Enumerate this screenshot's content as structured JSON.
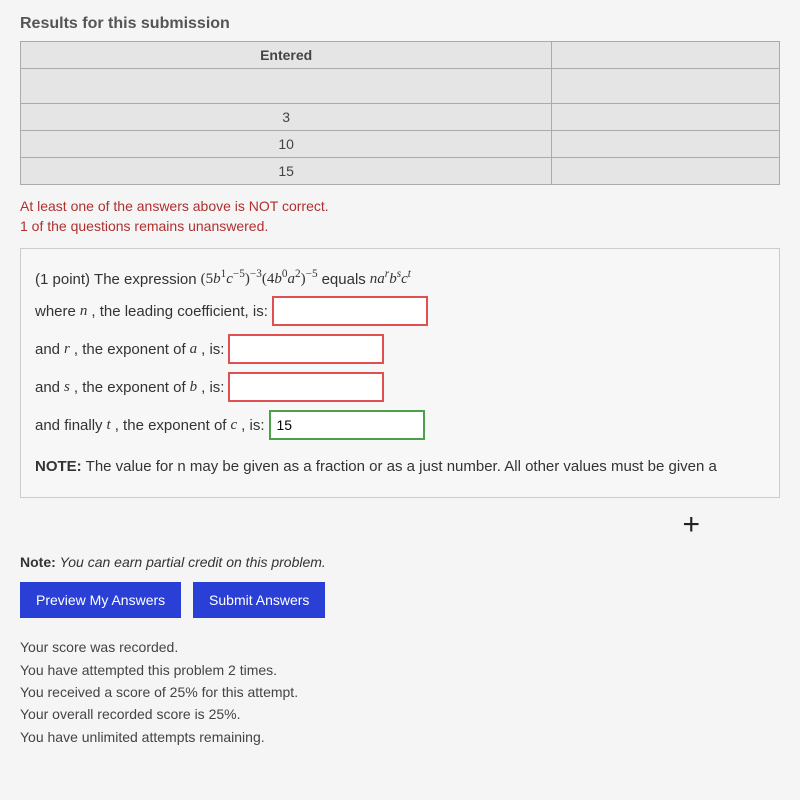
{
  "results": {
    "heading": "Results for this submission",
    "col1_header": "Entered",
    "col2_header": "",
    "rows": [
      "3",
      "10",
      "15"
    ]
  },
  "feedback": {
    "line1": "At least one of the answers above is NOT correct.",
    "line2": "1 of the questions remains unanswered."
  },
  "problem": {
    "points": "(1 point) ",
    "intro": "The expression ",
    "expr_html": "(5b¹c⁻⁵)⁻³(4b⁰a²)⁻⁵",
    "equals": " equals ",
    "target_html": "naʳbˢcᵗ",
    "n_label_pre": "where ",
    "n_label": ", the leading coefficient, is:",
    "r_label_pre": "and ",
    "r_label": ", the exponent of ",
    "r_label_post": ", is:",
    "s_label_pre": "and ",
    "s_label": ", the exponent of ",
    "s_label_post": ", is:",
    "t_label_pre": "and finally ",
    "t_label": ", the exponent of ",
    "t_label_post": ", is:",
    "var_n": "n",
    "var_r": "r",
    "var_a": "a",
    "var_s": "s",
    "var_b": "b",
    "var_t": "t",
    "var_c": "c",
    "inputs": {
      "n": "",
      "r": "",
      "s": "",
      "t": "15"
    },
    "note_label": "NOTE: ",
    "note_text": "The value for n may be given as a fraction or as a just number. All other values must be given a"
  },
  "partial_credit": {
    "label": "Note: ",
    "text": "You can earn partial credit on this problem."
  },
  "buttons": {
    "preview": "Preview My Answers",
    "submit": "Submit Answers"
  },
  "status": {
    "line1": "Your score was recorded.",
    "line2": "You have attempted this problem 2 times.",
    "line3": "You received a score of 25% for this attempt.",
    "line4": "Your overall recorded score is 25%.",
    "line5": "You have unlimited attempts remaining."
  },
  "icons": {
    "plus": "+"
  }
}
